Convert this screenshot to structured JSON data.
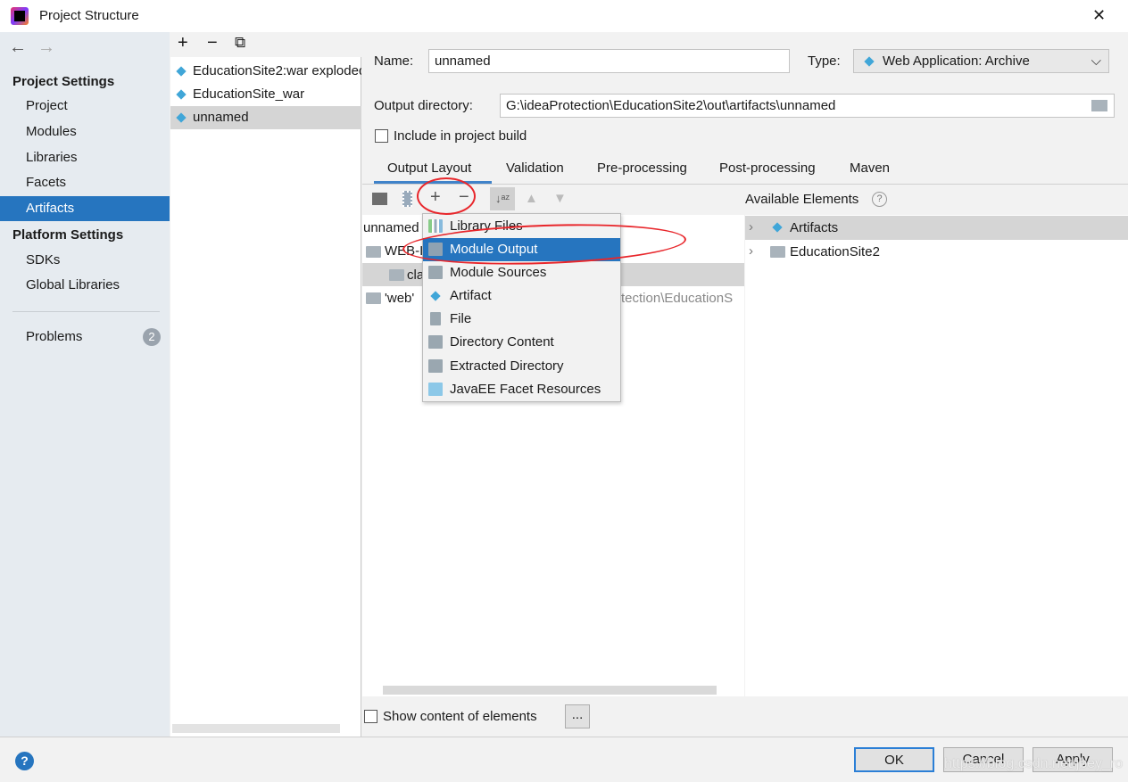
{
  "window": {
    "title": "Project Structure",
    "close": "✕"
  },
  "nav": {
    "back": "←",
    "forward": "→"
  },
  "sidebar": {
    "project_settings": "Project Settings",
    "items": [
      {
        "label": "Project"
      },
      {
        "label": "Modules"
      },
      {
        "label": "Libraries"
      },
      {
        "label": "Facets"
      },
      {
        "label": "Artifacts"
      }
    ],
    "platform_settings": "Platform Settings",
    "platform_items": [
      {
        "label": "SDKs"
      },
      {
        "label": "Global Libraries"
      }
    ],
    "problems": {
      "label": "Problems",
      "count": "2"
    }
  },
  "artifacts_list": {
    "toolbar": {
      "add": "+",
      "remove": "−",
      "copy": "⧉"
    },
    "items": [
      {
        "label": "EducationSite2:war exploded"
      },
      {
        "label": "EducationSite_war"
      },
      {
        "label": "unnamed"
      }
    ]
  },
  "main": {
    "name_label": "Name:",
    "name_value": "unnamed",
    "type_label": "Type:",
    "type_value": "Web Application: Archive",
    "output_dir_label": "Output directory:",
    "output_dir_value": "G:\\ideaProtection\\EducationSite2\\out\\artifacts\\unnamed",
    "include_label": "Include in project build",
    "tabs": [
      {
        "label": "Output Layout"
      },
      {
        "label": "Validation"
      },
      {
        "label": "Pre-processing"
      },
      {
        "label": "Post-processing"
      },
      {
        "label": "Maven"
      }
    ],
    "tree": [
      {
        "label": "unnamed"
      },
      {
        "label": "WEB-INF"
      },
      {
        "label": "classes"
      },
      {
        "label": "'web'",
        "detail": "tection\\EducationS"
      }
    ],
    "available_label": "Available Elements",
    "available": [
      {
        "label": "Artifacts"
      },
      {
        "label": "EducationSite2"
      }
    ],
    "show_content_label": "Show content of elements",
    "ellipsis": "..."
  },
  "menu": {
    "items": [
      {
        "label": "Library Files"
      },
      {
        "label": "Module Output"
      },
      {
        "label": "Module Sources"
      },
      {
        "label": "Artifact"
      },
      {
        "label": "File"
      },
      {
        "label": "Directory Content"
      },
      {
        "label": "Extracted Directory"
      },
      {
        "label": "JavaEE Facet Resources"
      }
    ]
  },
  "footer": {
    "help": "?",
    "ok": "OK",
    "cancel": "Cancel",
    "apply": "Apply",
    "watermark": "https://blog.csdn.net/jbey_ro"
  },
  "colors": {
    "accent": "#2675bf",
    "annotation": "#e8262b"
  }
}
